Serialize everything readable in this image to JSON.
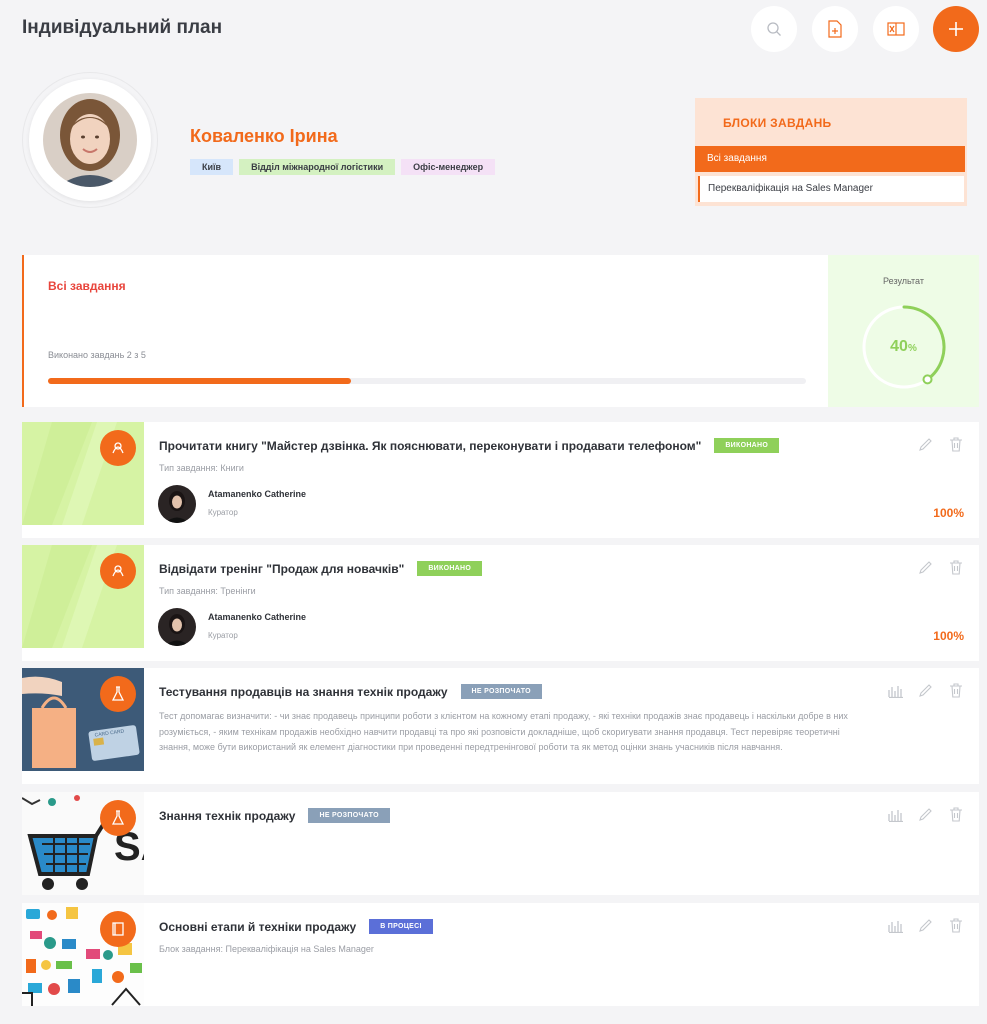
{
  "page": {
    "title": "Індивідуальний план"
  },
  "toolbar": {
    "search_icon": "search-icon",
    "add_file_icon": "add-file-icon",
    "excel_icon": "excel-icon",
    "add_icon": "plus-icon"
  },
  "profile": {
    "name": "Коваленко Ірина",
    "tags": [
      "Київ",
      "Відділ міжнародної логістики",
      "Офіс-менеджер"
    ]
  },
  "blocks": {
    "title": "БЛОКИ ЗАВДАНЬ",
    "items": [
      {
        "label": "Всі завдання",
        "active": true
      },
      {
        "label": "Перекваліфікація на Sales Manager",
        "active": false
      }
    ]
  },
  "summary": {
    "title": "Всі завдання",
    "count_text": "Виконано завдань 2 з 5",
    "progress_fraction": 0.4
  },
  "result": {
    "label": "Результат",
    "value": "40",
    "unit": "%",
    "fraction": 0.4
  },
  "colors": {
    "accent": "#f26a1b",
    "done": "#8fd05a",
    "not_started": "#8aa0b8",
    "in_progress": "#5b6fd8"
  },
  "tasks": [
    {
      "title": "Прочитати книгу \"Майстер дзвінка. Як пояснювати, переконувати і продавати телефоном\"",
      "status": "ВИКОНАНО",
      "type": "Тип завдання: Книги",
      "curator_name": "Atamanenko Catherine",
      "curator_role": "Куратор",
      "percent": "100%"
    },
    {
      "title": "Відвідати тренінг \"Продаж для новачків\"",
      "status": "ВИКОНАНО",
      "type": "Тип завдання: Тренінги",
      "curator_name": "Atamanenko Catherine",
      "curator_role": "Куратор",
      "percent": "100%"
    },
    {
      "title": "Тестування продавців на знання технік продажу",
      "status": "НЕ РОЗПОЧАТО",
      "description": "Тест допомагає визначити: - чи знає продавець принципи роботи з клієнтом на кожному етапі продажу, - які техніки продажів знає продавець і наскільки добре в них розуміється, - яким технікам продажів необхідно навчити продавці та про які розповісти докладніше, щоб скоригувати знання продавця. Тест перевіряє теоретичні знання, може бути використаний як елемент діагностики при проведенні передтренінгової роботи та як метод оцінки знань учасників після навчання."
    },
    {
      "title": "Знання технік продажу",
      "status": "НЕ РОЗПОЧАТО"
    },
    {
      "title": "Основні етапи й техніки продажу",
      "status": "В ПРОЦЕСІ",
      "type": "Блок завдання: Перекваліфікація на Sales Manager"
    }
  ],
  "thumb_texts": {
    "card": "CARD CARD",
    "sale_word": "SA"
  }
}
